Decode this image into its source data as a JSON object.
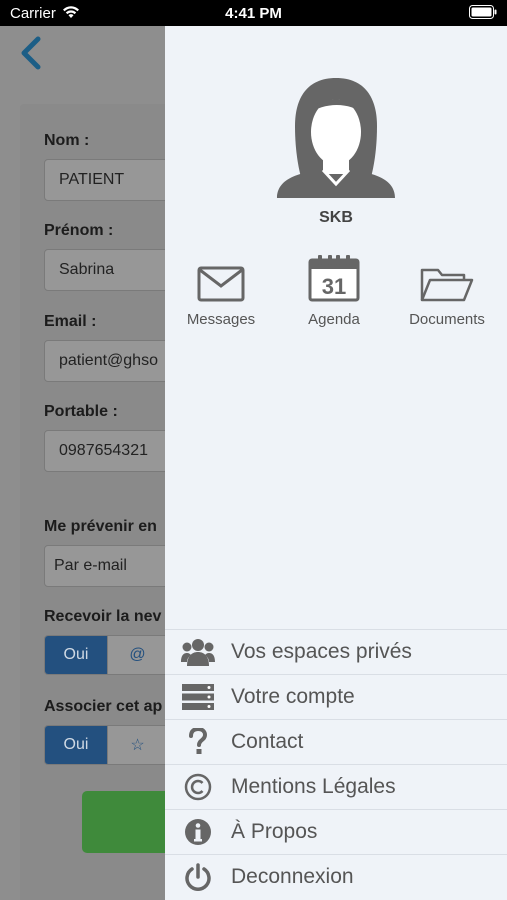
{
  "status_bar": {
    "carrier": "Carrier",
    "time": "4:41 PM"
  },
  "form": {
    "fields": [
      {
        "label": "Nom :",
        "value": "PATIENT"
      },
      {
        "label": "Prénom :",
        "value": "Sabrina"
      },
      {
        "label": "Email :",
        "value": "patient@ghso"
      },
      {
        "label": "Portable :",
        "value": "0987654321"
      }
    ],
    "notify_label": "Me prévenir en",
    "notify_value": "Par e-mail",
    "newsletter_label": "Recevoir la nev",
    "newsletter_on": "Oui",
    "associate_label": "Associer cet ap",
    "associate_on": "Oui"
  },
  "drawer": {
    "user_name": "SKB",
    "quick_links": [
      {
        "label": "Messages",
        "icon": "envelope-icon"
      },
      {
        "label": "Agenda",
        "icon": "calendar-icon",
        "day": "31"
      },
      {
        "label": "Documents",
        "icon": "folder-icon"
      }
    ],
    "menu": [
      {
        "label": "Vos espaces privés",
        "icon": "group-icon"
      },
      {
        "label": "Votre compte",
        "icon": "server-icon"
      },
      {
        "label": "Contact",
        "icon": "question-icon"
      },
      {
        "label": "Mentions Légales",
        "icon": "copyright-icon"
      },
      {
        "label": "À Propos",
        "icon": "info-icon"
      },
      {
        "label": "Deconnexion",
        "icon": "power-icon"
      }
    ]
  },
  "colors": {
    "accent": "#23507f",
    "drawer_bg": "#eff3f8",
    "dim_bg": "#8e8e8e",
    "button_green": "#3f8a3b"
  }
}
